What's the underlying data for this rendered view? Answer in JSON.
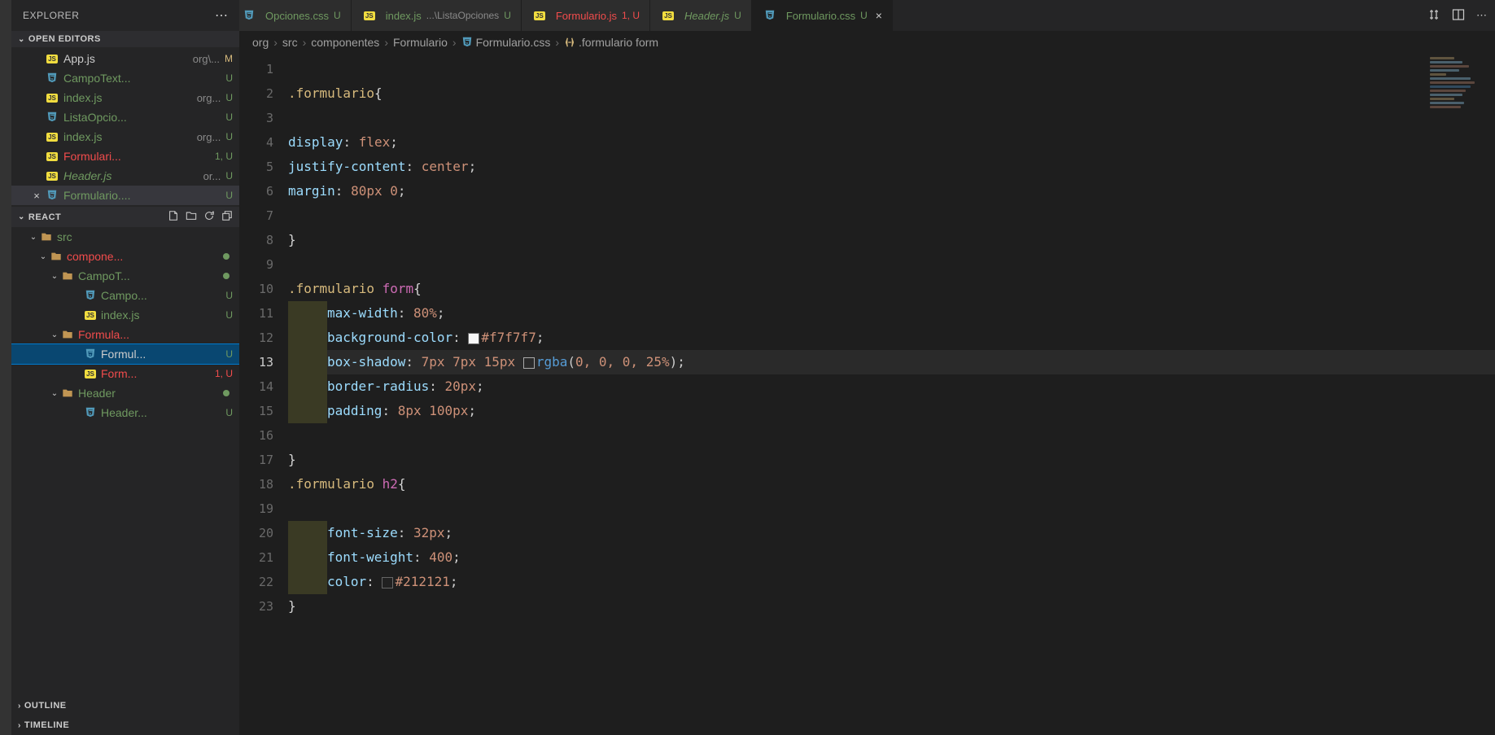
{
  "sidebar": {
    "title": "EXPLORER",
    "openEditorsLabel": "OPEN EDITORS",
    "reactLabel": "REACT",
    "outlineLabel": "OUTLINE",
    "timelineLabel": "TIMELINE",
    "openEditors": [
      {
        "icon": "js",
        "name": "App.js",
        "path": "org\\...",
        "status": "M",
        "statusClass": "modified",
        "close": false
      },
      {
        "icon": "css",
        "name": "CampoText...",
        "path": "",
        "status": "U",
        "nameClass": "untracked",
        "close": false
      },
      {
        "icon": "js",
        "name": "index.js",
        "path": "org...",
        "status": "U",
        "nameClass": "untracked",
        "close": false
      },
      {
        "icon": "css",
        "name": "ListaOpcio...",
        "path": "",
        "status": "U",
        "nameClass": "untracked",
        "close": false
      },
      {
        "icon": "js",
        "name": "index.js",
        "path": "org...",
        "status": "U",
        "nameClass": "untracked",
        "close": false
      },
      {
        "icon": "js",
        "name": "Formulari...",
        "path": "",
        "status": "1, U",
        "nameClass": "error",
        "close": false
      },
      {
        "icon": "js",
        "name": "Header.js",
        "path": "or...",
        "status": "U",
        "nameClass": "untracked italic",
        "close": false
      },
      {
        "icon": "css",
        "name": "Formulario....",
        "path": "",
        "status": "U",
        "nameClass": "untracked",
        "close": true
      }
    ],
    "tree": [
      {
        "indent": 12,
        "chev": "⌄",
        "folder": true,
        "name": "src",
        "nameClass": "untracked",
        "dot": false,
        "status": ""
      },
      {
        "indent": 24,
        "chev": "⌄",
        "folder": true,
        "name": "compone...",
        "nameClass": "error",
        "dot": true,
        "status": ""
      },
      {
        "indent": 38,
        "chev": "⌄",
        "folder": true,
        "name": "CampoT...",
        "nameClass": "untracked",
        "dot": true,
        "status": ""
      },
      {
        "indent": 66,
        "chev": "",
        "folder": false,
        "icon": "css",
        "name": "Campo...",
        "nameClass": "untracked",
        "status": "U"
      },
      {
        "indent": 66,
        "chev": "",
        "folder": false,
        "icon": "js",
        "name": "index.js",
        "nameClass": "untracked",
        "status": "U"
      },
      {
        "indent": 38,
        "chev": "⌄",
        "folder": true,
        "name": "Formula...",
        "nameClass": "error",
        "dot": false,
        "status": ""
      },
      {
        "indent": 66,
        "chev": "",
        "folder": false,
        "icon": "css",
        "name": "Formul...",
        "nameClass": "",
        "status": "U",
        "active": true
      },
      {
        "indent": 66,
        "chev": "",
        "folder": false,
        "icon": "js",
        "name": "Form...",
        "nameClass": "error",
        "status": "1, U",
        "statusClass": "error"
      },
      {
        "indent": 38,
        "chev": "⌄",
        "folder": true,
        "name": "Header",
        "nameClass": "untracked",
        "dot": true,
        "status": ""
      },
      {
        "indent": 66,
        "chev": "",
        "folder": false,
        "icon": "css",
        "name": "Header...",
        "nameClass": "untracked",
        "status": "U"
      }
    ]
  },
  "tabs": [
    {
      "icon": "css",
      "label": "Opciones.css",
      "status": "U",
      "labelClass": "untracked partial"
    },
    {
      "icon": "js",
      "label": "index.js",
      "sub": "...\\ListaOpciones",
      "status": "U",
      "labelClass": "untracked"
    },
    {
      "icon": "js",
      "label": "Formulario.js",
      "status": "1, U",
      "labelClass": "error",
      "statusClass": "error"
    },
    {
      "icon": "js",
      "label": "Header.js",
      "status": "U",
      "labelClass": "untracked italic"
    },
    {
      "icon": "css",
      "label": "Formulario.css",
      "status": "U",
      "labelClass": "untracked",
      "active": true,
      "close": true
    }
  ],
  "breadcrumbs": [
    "org",
    "src",
    "componentes",
    "Formulario",
    "Formulario.css",
    ".formulario form"
  ],
  "breadcrumb_icons": {
    "4": "css",
    "5": "rule"
  },
  "code": {
    "activeLine": 13,
    "lines": [
      {
        "n": 1,
        "tokens": []
      },
      {
        "n": 2,
        "tokens": [
          {
            "t": ".formulario",
            "c": "c-sel"
          },
          {
            "t": "{",
            "c": "c-brace"
          }
        ]
      },
      {
        "n": 3,
        "tokens": []
      },
      {
        "n": 4,
        "tokens": [
          {
            "t": "display",
            "c": "c-prop"
          },
          {
            "t": ": ",
            "c": "c-punc"
          },
          {
            "t": "flex",
            "c": "c-val"
          },
          {
            "t": ";",
            "c": "c-punc"
          }
        ]
      },
      {
        "n": 5,
        "tokens": [
          {
            "t": "justify-content",
            "c": "c-prop"
          },
          {
            "t": ": ",
            "c": "c-punc"
          },
          {
            "t": "center",
            "c": "c-val"
          },
          {
            "t": ";",
            "c": "c-punc"
          }
        ]
      },
      {
        "n": 6,
        "tokens": [
          {
            "t": "margin",
            "c": "c-prop"
          },
          {
            "t": ": ",
            "c": "c-punc"
          },
          {
            "t": "80px 0",
            "c": "c-num"
          },
          {
            "t": ";",
            "c": "c-punc"
          }
        ]
      },
      {
        "n": 7,
        "tokens": []
      },
      {
        "n": 8,
        "tokens": [
          {
            "t": "}",
            "c": "c-brace"
          }
        ]
      },
      {
        "n": 9,
        "tokens": []
      },
      {
        "n": 10,
        "tokens": [
          {
            "t": ".formulario ",
            "c": "c-sel"
          },
          {
            "t": "form",
            "c": "c-tag"
          },
          {
            "t": "{",
            "c": "c-brace"
          }
        ]
      },
      {
        "n": 11,
        "ind": true,
        "tokens": [
          {
            "t": "max-width",
            "c": "c-prop"
          },
          {
            "t": ": ",
            "c": "c-punc"
          },
          {
            "t": "80%",
            "c": "c-num"
          },
          {
            "t": ";",
            "c": "c-punc"
          }
        ]
      },
      {
        "n": 12,
        "ind": true,
        "tokens": [
          {
            "t": "background-color",
            "c": "c-prop"
          },
          {
            "t": ": ",
            "c": "c-punc"
          },
          {
            "swatch": "#f7f7f7"
          },
          {
            "t": "#f7f7f7",
            "c": "c-hex"
          },
          {
            "t": ";",
            "c": "c-punc"
          }
        ]
      },
      {
        "n": 13,
        "ind": true,
        "tokens": [
          {
            "t": "box-shadow",
            "c": "c-prop"
          },
          {
            "t": ": ",
            "c": "c-punc"
          },
          {
            "t": "7px 7px 15px ",
            "c": "c-num"
          },
          {
            "swatch": "transparent",
            "border": true
          },
          {
            "t": "rgba",
            "c": "c-func"
          },
          {
            "t": "(",
            "c": "c-punc"
          },
          {
            "t": "0, 0, 0, 25%",
            "c": "c-num"
          },
          {
            "t": ")",
            "c": "c-punc"
          },
          {
            "t": ";",
            "c": "c-punc"
          }
        ]
      },
      {
        "n": 14,
        "ind": true,
        "tokens": [
          {
            "t": "border-radius",
            "c": "c-prop"
          },
          {
            "t": ": ",
            "c": "c-punc"
          },
          {
            "t": "20px",
            "c": "c-num"
          },
          {
            "t": ";",
            "c": "c-punc"
          }
        ]
      },
      {
        "n": 15,
        "ind": true,
        "tokens": [
          {
            "t": "padding",
            "c": "c-prop"
          },
          {
            "t": ": ",
            "c": "c-punc"
          },
          {
            "t": "8px 100px",
            "c": "c-num"
          },
          {
            "t": ";",
            "c": "c-punc"
          }
        ]
      },
      {
        "n": 16,
        "tokens": []
      },
      {
        "n": 17,
        "tokens": [
          {
            "t": "}",
            "c": "c-brace"
          }
        ]
      },
      {
        "n": 18,
        "tokens": [
          {
            "t": ".formulario ",
            "c": "c-sel"
          },
          {
            "t": "h2",
            "c": "c-tag"
          },
          {
            "t": "{",
            "c": "c-brace"
          }
        ]
      },
      {
        "n": 19,
        "tokens": []
      },
      {
        "n": 20,
        "ind": true,
        "tokens": [
          {
            "t": "font-size",
            "c": "c-prop"
          },
          {
            "t": ": ",
            "c": "c-punc"
          },
          {
            "t": "32px",
            "c": "c-num"
          },
          {
            "t": ";",
            "c": "c-punc"
          }
        ]
      },
      {
        "n": 21,
        "ind": true,
        "tokens": [
          {
            "t": "font-weight",
            "c": "c-prop"
          },
          {
            "t": ": ",
            "c": "c-punc"
          },
          {
            "t": "400",
            "c": "c-num"
          },
          {
            "t": ";",
            "c": "c-punc"
          }
        ]
      },
      {
        "n": 22,
        "ind": true,
        "tokens": [
          {
            "t": "color",
            "c": "c-prop"
          },
          {
            "t": ": ",
            "c": "c-punc"
          },
          {
            "swatch": "#212121"
          },
          {
            "t": "#212121",
            "c": "c-hex"
          },
          {
            "t": ";",
            "c": "c-punc"
          }
        ]
      },
      {
        "n": 23,
        "tokens": [
          {
            "t": "}",
            "c": "c-brace"
          }
        ]
      }
    ]
  }
}
